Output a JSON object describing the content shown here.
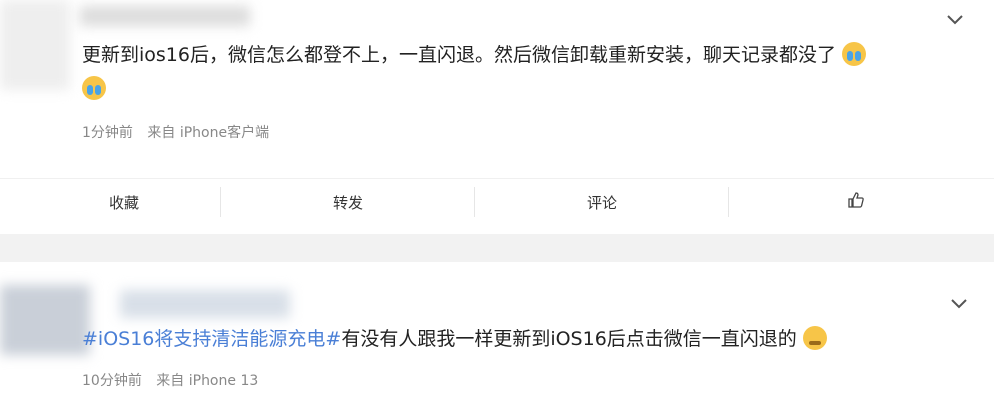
{
  "post1": {
    "text_line1": "更新到ios16后，微信怎么都登不上，一直闪退。然后微信卸载重新安装，聊天记录都没了",
    "meta_time": "1分钟前",
    "meta_source": "来自 iPhone客户端",
    "actions": {
      "favorite": "收藏",
      "repost": "转发",
      "comment": "评论"
    },
    "icons": {
      "more": "chevron-down-icon",
      "like": "thumbs-up-icon",
      "emoji": "crying-emoji-icon"
    }
  },
  "post2": {
    "topic": "#iOS16将支持清洁能源充电#",
    "text": "有没有人跟我一样更新到iOS16后点击微信一直闪退的",
    "meta_time": "10分钟前",
    "meta_source": "来自 iPhone 13",
    "icons": {
      "more": "chevron-down-icon",
      "emoji": "sweat-smile-emoji-icon"
    }
  },
  "colors": {
    "topic_link": "#4a7fd6",
    "meta_text": "#888888",
    "separator": "#f2f2f2"
  }
}
